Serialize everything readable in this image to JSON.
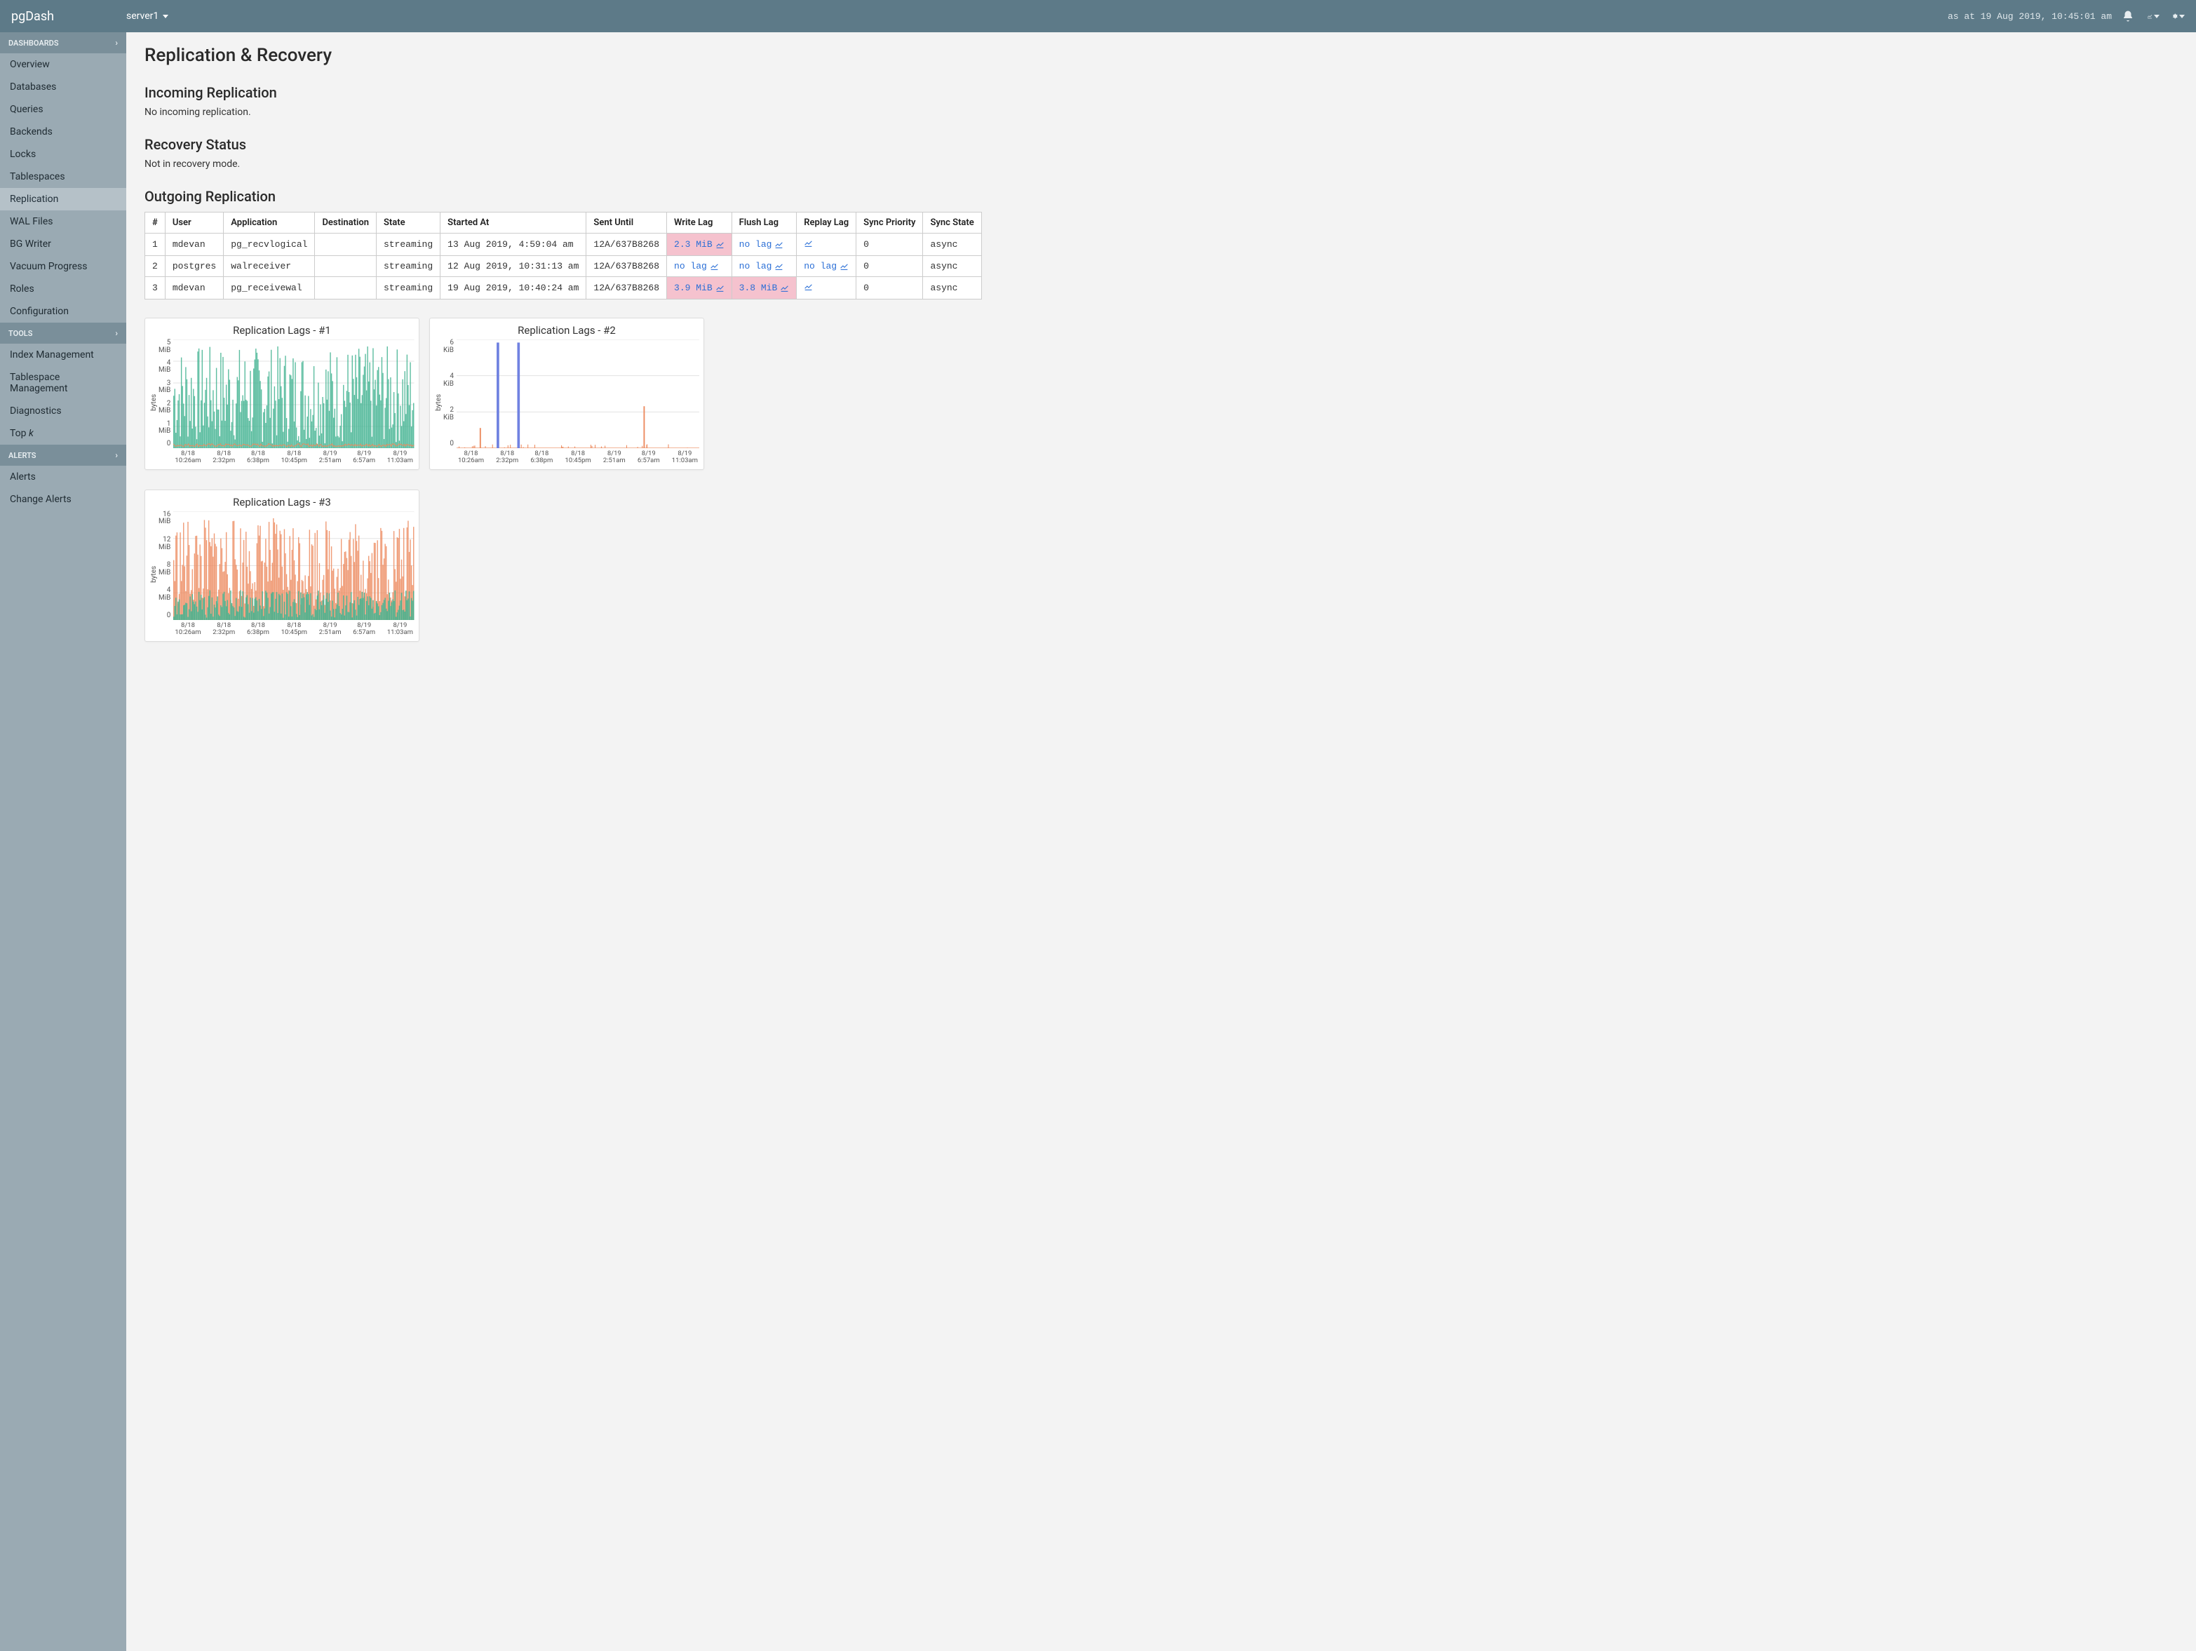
{
  "brand": "pgDash",
  "server_selector": {
    "current": "server1"
  },
  "as_at": "as at 19 Aug 2019, 10:45:01 am",
  "sidebar": {
    "sections": [
      {
        "title": "DASHBOARDS",
        "items": [
          {
            "label": "Overview"
          },
          {
            "label": "Databases"
          },
          {
            "label": "Queries"
          },
          {
            "label": "Backends"
          },
          {
            "label": "Locks"
          },
          {
            "label": "Tablespaces"
          },
          {
            "label": "Replication",
            "active": true
          },
          {
            "label": "WAL Files"
          },
          {
            "label": "BG Writer"
          },
          {
            "label": "Vacuum Progress"
          },
          {
            "label": "Roles"
          },
          {
            "label": "Configuration"
          }
        ]
      },
      {
        "title": "TOOLS",
        "items": [
          {
            "label": "Index Management"
          },
          {
            "label": "Tablespace Management"
          },
          {
            "label": "Diagnostics"
          },
          {
            "label_html": "Top <span class=\"ital\">k</span>"
          }
        ]
      },
      {
        "title": "ALERTS",
        "items": [
          {
            "label": "Alerts"
          },
          {
            "label": "Change Alerts"
          }
        ]
      }
    ]
  },
  "page": {
    "title": "Replication & Recovery",
    "incoming": {
      "heading": "Incoming Replication",
      "body": "No incoming replication."
    },
    "recovery": {
      "heading": "Recovery Status",
      "body": "Not in recovery mode."
    },
    "outgoing": {
      "heading": "Outgoing Replication",
      "headers": [
        "#",
        "User",
        "Application",
        "Destination",
        "State",
        "Started At",
        "Sent Until",
        "Write Lag",
        "Flush Lag",
        "Replay Lag",
        "Sync Priority",
        "Sync State"
      ],
      "rows": [
        {
          "n": "1",
          "user": "mdevan",
          "app": "pg_recvlogical",
          "dest": "",
          "state": "streaming",
          "started": "13 Aug 2019, 4:59:04 am",
          "sent": "12A/637B8268",
          "write": {
            "text": "2.3 MiB",
            "warn": true,
            "link": true
          },
          "flush": {
            "text": "no lag",
            "warn": false,
            "link": true
          },
          "replay": {
            "text": "",
            "warn": false,
            "link": true
          },
          "prio": "0",
          "sync": "async"
        },
        {
          "n": "2",
          "user": "postgres",
          "app": "walreceiver",
          "dest": "",
          "state": "streaming",
          "started": "12 Aug 2019, 10:31:13 am",
          "sent": "12A/637B8268",
          "write": {
            "text": "no lag",
            "warn": false,
            "link": true
          },
          "flush": {
            "text": "no lag",
            "warn": false,
            "link": true
          },
          "replay": {
            "text": "no lag",
            "warn": false,
            "link": true
          },
          "prio": "0",
          "sync": "async"
        },
        {
          "n": "3",
          "user": "mdevan",
          "app": "pg_receivewal",
          "dest": "",
          "state": "streaming",
          "started": "19 Aug 2019, 10:40:24 am",
          "sent": "12A/637B8268",
          "write": {
            "text": "3.9 MiB",
            "warn": true,
            "link": true
          },
          "flush": {
            "text": "3.8 MiB",
            "warn": true,
            "link": true
          },
          "replay": {
            "text": "",
            "warn": false,
            "link": true
          },
          "prio": "0",
          "sync": "async"
        }
      ]
    }
  },
  "chart_data": [
    {
      "id": "chart1",
      "title": "Replication Lags - #1",
      "type": "bar",
      "ylabel": "bytes",
      "colors": {
        "a": "#3fb28f",
        "b": "#ec8a5e"
      },
      "y_ticks": [
        "5\nMiB",
        "4\nMiB",
        "3\nMiB",
        "2\nMiB",
        "1\nMiB",
        "0"
      ],
      "ylim": [
        0,
        5.4
      ],
      "x_ticks": [
        "8/18\n10:26am",
        "8/18\n2:32pm",
        "8/18\n6:38pm",
        "8/18\n10:45pm",
        "8/19\n2:51am",
        "8/19\n6:57am",
        "8/19\n11:03am"
      ],
      "n": 220,
      "density": "dense",
      "series_b_baseline": 0.15
    },
    {
      "id": "chart2",
      "title": "Replication Lags - #2",
      "type": "bar",
      "ylabel": "bytes",
      "colors": {
        "a": "#6d7fe0",
        "b": "#ec8a5e"
      },
      "y_ticks": [
        "6\nKiB",
        "4\nKiB",
        "2\nKiB",
        "0"
      ],
      "ylim": [
        0,
        7.0
      ],
      "x_ticks": [
        "8/18\n10:26am",
        "8/18\n2:32pm",
        "8/18\n6:38pm",
        "8/18\n10:45pm",
        "8/19\n2:51am",
        "8/19\n6:57am",
        "8/19\n11:03am"
      ],
      "n": 220,
      "density": "sparse",
      "spikes": [
        {
          "x": 0.095,
          "h": 1.3,
          "c": "b"
        },
        {
          "x": 0.165,
          "h": 6.8,
          "c": "a"
        },
        {
          "x": 0.17,
          "h": 6.8,
          "c": "a"
        },
        {
          "x": 0.25,
          "h": 6.8,
          "c": "a"
        },
        {
          "x": 0.255,
          "h": 6.8,
          "c": "a"
        },
        {
          "x": 0.77,
          "h": 2.7,
          "c": "b"
        }
      ]
    },
    {
      "id": "chart3",
      "title": "Replication Lags - #3",
      "type": "bar",
      "ylabel": "bytes",
      "colors": {
        "a": "#3fb28f",
        "b": "#ec8a5e"
      },
      "y_ticks": [
        "16\nMiB",
        "12\nMiB",
        "8\nMiB",
        "4\nMiB",
        "0"
      ],
      "ylim": [
        0,
        17.5
      ],
      "x_ticks": [
        "8/18\n10:26am",
        "8/18\n2:32pm",
        "8/18\n6:38pm",
        "8/18\n10:45pm",
        "8/19\n2:51am",
        "8/19\n6:57am",
        "8/19\n11:03am"
      ],
      "n": 220,
      "density": "dense-dual",
      "series_a_scale": 0.3
    }
  ]
}
